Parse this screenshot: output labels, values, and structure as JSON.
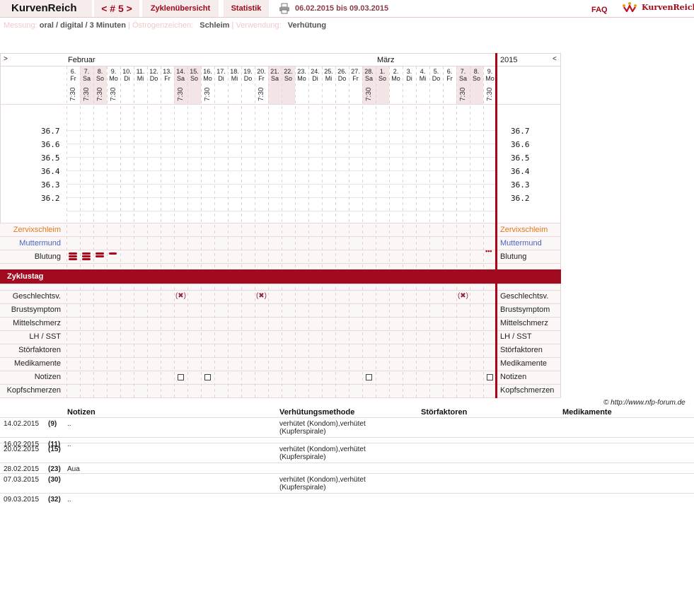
{
  "header": {
    "brand": "KurvenReich",
    "cycle_nav": "< # 5 >",
    "nav": [
      "Zyklenübersicht",
      "Statistik"
    ],
    "date_range": "06.02.2015 bis 09.03.2015",
    "faq": "FAQ",
    "logo_text": "KurvenReich"
  },
  "info": {
    "measure_label": "Messung:",
    "measure_value": "oral / digital / 3 Minuten",
    "estrogen_label": "Östrogenzeichen:",
    "estrogen_value": "Schleim",
    "usage_label": "Verwendung:",
    "usage_value": "Verhütung"
  },
  "chart": {
    "left_corner": ">",
    "right_corner": "<",
    "year": "2015",
    "months": [
      "Februar",
      "März"
    ],
    "days": [
      {
        "d": "6.",
        "w": "Fr",
        "t": "7:30"
      },
      {
        "d": "7.",
        "w": "Sa",
        "t": "7:30"
      },
      {
        "d": "8.",
        "w": "So",
        "t": "7:30"
      },
      {
        "d": "9.",
        "w": "Mo",
        "t": "7:30"
      },
      {
        "d": "10.",
        "w": "Di",
        "t": ""
      },
      {
        "d": "11.",
        "w": "Mi",
        "t": ""
      },
      {
        "d": "12.",
        "w": "Do",
        "t": ""
      },
      {
        "d": "13.",
        "w": "Fr",
        "t": ""
      },
      {
        "d": "14.",
        "w": "Sa",
        "t": "7:30"
      },
      {
        "d": "15.",
        "w": "So",
        "t": ""
      },
      {
        "d": "16.",
        "w": "Mo",
        "t": "7:30"
      },
      {
        "d": "17.",
        "w": "Di",
        "t": ""
      },
      {
        "d": "18.",
        "w": "Mi",
        "t": ""
      },
      {
        "d": "19.",
        "w": "Do",
        "t": ""
      },
      {
        "d": "20.",
        "w": "Fr",
        "t": "7:30"
      },
      {
        "d": "21.",
        "w": "Sa",
        "t": ""
      },
      {
        "d": "22.",
        "w": "So",
        "t": ""
      },
      {
        "d": "23.",
        "w": "Mo",
        "t": ""
      },
      {
        "d": "24.",
        "w": "Di",
        "t": ""
      },
      {
        "d": "25.",
        "w": "Mi",
        "t": ""
      },
      {
        "d": "26.",
        "w": "Do",
        "t": ""
      },
      {
        "d": "27.",
        "w": "Fr",
        "t": ""
      },
      {
        "d": "28.",
        "w": "Sa",
        "t": "7:30"
      },
      {
        "d": "1.",
        "w": "So",
        "t": ""
      },
      {
        "d": "2.",
        "w": "Mo",
        "t": ""
      },
      {
        "d": "3.",
        "w": "Di",
        "t": ""
      },
      {
        "d": "4.",
        "w": "Mi",
        "t": ""
      },
      {
        "d": "5.",
        "w": "Do",
        "t": ""
      },
      {
        "d": "6.",
        "w": "Fr",
        "t": ""
      },
      {
        "d": "7.",
        "w": "Sa",
        "t": "7:30"
      },
      {
        "d": "8.",
        "w": "So",
        "t": ""
      },
      {
        "d": "9.",
        "w": "Mo",
        "t": "7:30"
      }
    ],
    "temps": [
      "36.7",
      "36.6",
      "36.5",
      "36.4",
      "36.3",
      "36.2"
    ],
    "rows_top": [
      "Zervixschleim",
      "Muttermund",
      "Blutung"
    ],
    "zyklustag": "Zyklustag",
    "rows_bottom": [
      "Geschlechtsv.",
      "Brustsymptom",
      "Mittelschmerz",
      "LH / SST",
      "Störfaktoren",
      "Medikamente",
      "Notizen",
      "Kopfschmerzen"
    ],
    "colors": {
      "zervix": "#e07a1a",
      "muttermund": "#4a62c0",
      "accent": "#a20a1f"
    },
    "bleeding_days": [
      1,
      2,
      3,
      4
    ],
    "spotting_day": 32,
    "intercourse_days": [
      9,
      15,
      30
    ],
    "notes_days": [
      9,
      11,
      23,
      32
    ]
  },
  "copyright": "© http://www.nfp-forum.de",
  "table": {
    "headers": [
      "Notizen",
      "Verhütungsmethode",
      "Störfaktoren",
      "Medikamente"
    ],
    "rows": [
      {
        "date": "14.02.2015",
        "day": "(9)",
        "note": "..",
        "method": "verhütet (Kondom),verhütet (Kupferspirale)"
      },
      {
        "date": "16.02.2015",
        "day": "(11)",
        "note": "..",
        "method": ""
      },
      {
        "date": "20.02.2015",
        "day": "(15)",
        "note": "",
        "method": "verhütet (Kondom),verhütet (Kupferspirale)"
      },
      {
        "date": "28.02.2015",
        "day": "(23)",
        "note": "Aua",
        "method": ""
      },
      {
        "date": "07.03.2015",
        "day": "(30)",
        "note": "",
        "method": "verhütet (Kondom),verhütet (Kupferspirale)"
      },
      {
        "date": "09.03.2015",
        "day": "(32)",
        "note": "..",
        "method": ""
      }
    ]
  }
}
